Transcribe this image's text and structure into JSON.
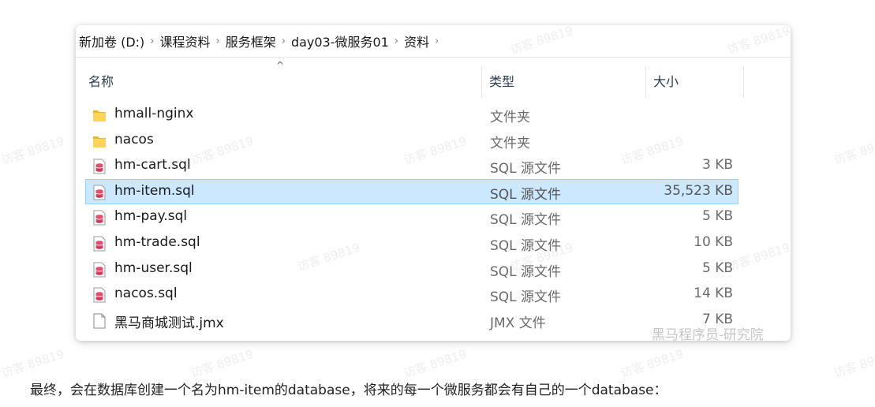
{
  "breadcrumb": [
    "新加卷 (D:)",
    "课程资料",
    "服务框架",
    "day03-微服务01",
    "资料"
  ],
  "breadcrumb_sep": "›",
  "columns": {
    "name": "名称",
    "type": "类型",
    "size": "大小",
    "sort_indicator": "^"
  },
  "files": [
    {
      "name": "hmall-nginx",
      "type": "文件夹",
      "size": "",
      "icon": "folder-icon",
      "selected": false
    },
    {
      "name": "nacos",
      "type": "文件夹",
      "size": "",
      "icon": "folder-icon",
      "selected": false
    },
    {
      "name": "hm-cart.sql",
      "type": "SQL 源文件",
      "size": "3 KB",
      "icon": "sql-file-icon",
      "selected": false
    },
    {
      "name": "hm-item.sql",
      "type": "SQL 源文件",
      "size": "35,523 KB",
      "icon": "sql-file-icon",
      "selected": true
    },
    {
      "name": "hm-pay.sql",
      "type": "SQL 源文件",
      "size": "5 KB",
      "icon": "sql-file-icon",
      "selected": false
    },
    {
      "name": "hm-trade.sql",
      "type": "SQL 源文件",
      "size": "10 KB",
      "icon": "sql-file-icon",
      "selected": false
    },
    {
      "name": "hm-user.sql",
      "type": "SQL 源文件",
      "size": "5 KB",
      "icon": "sql-file-icon",
      "selected": false
    },
    {
      "name": "nacos.sql",
      "type": "SQL 源文件",
      "size": "14 KB",
      "icon": "sql-file-icon",
      "selected": false
    },
    {
      "name": "黑马商城测试.jmx",
      "type": "JMX 文件",
      "size": "7 KB",
      "icon": "blank-file-icon",
      "selected": false
    }
  ],
  "corner_watermark": "黑马程序员-研究院",
  "watermark_text": "访客 89819",
  "caption": "最终，会在数据库创建一个名为hm-item的database，将来的每一个微服务都会有自己的一个database："
}
